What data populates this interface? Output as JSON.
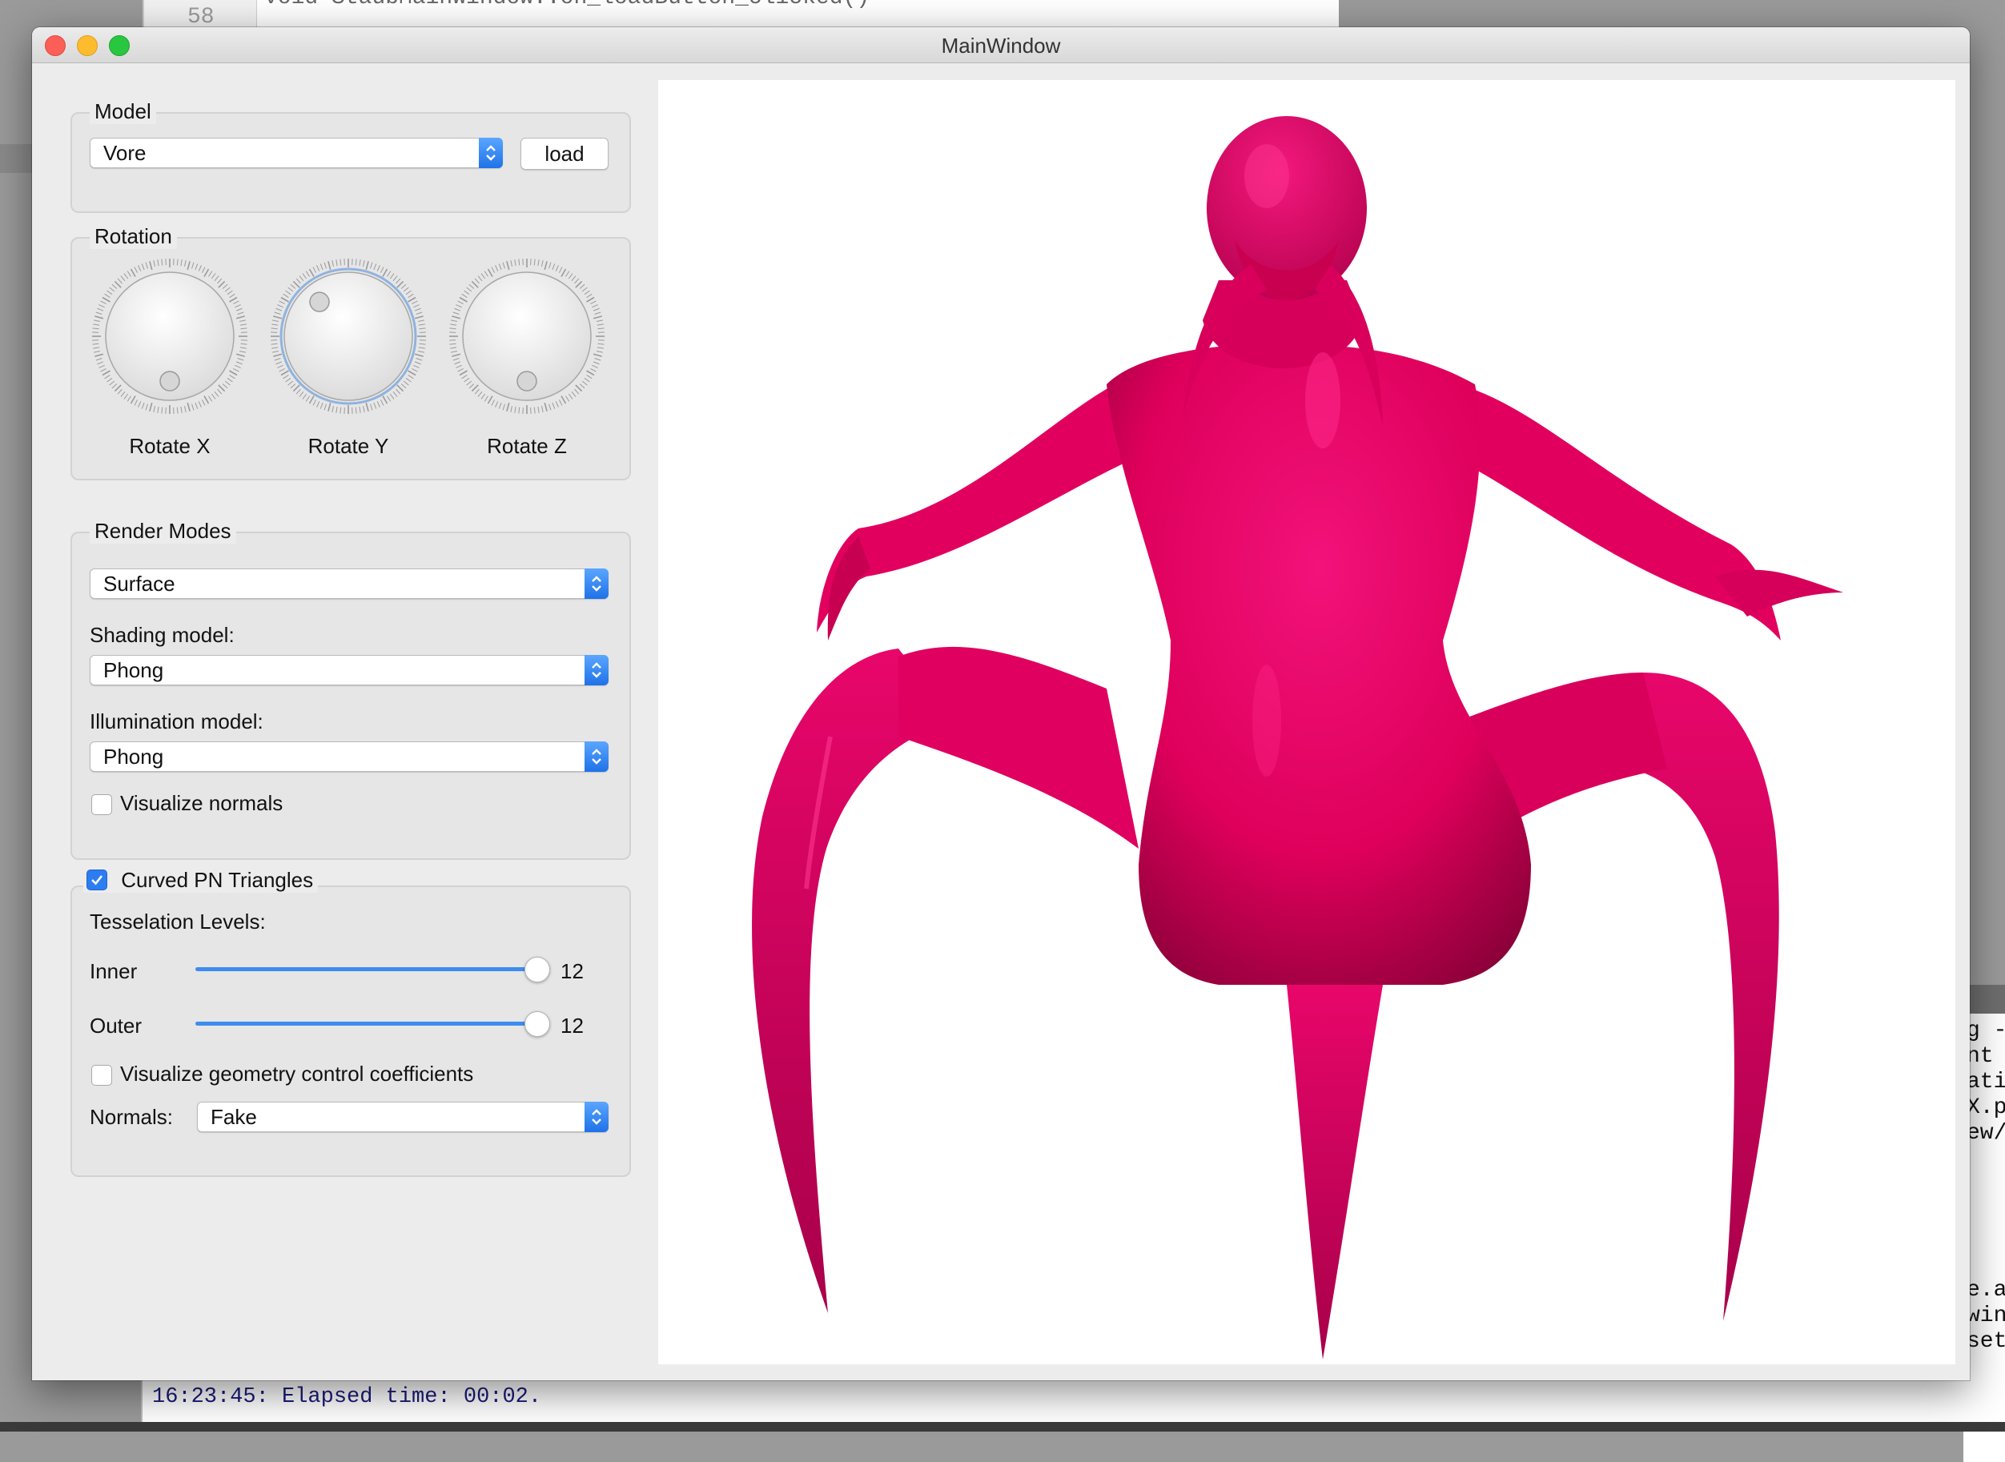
{
  "background": {
    "editor_line_no": "58",
    "editor_code": "void StaubMainWindow::on_loadButton_clicked()",
    "console_text": "16:23:45: Elapsed time: 00:02.",
    "right_terminal_lines": [
      "g -",
      "nt",
      "atio",
      "X.p",
      "ew/",
      "e.a",
      "win",
      "set"
    ]
  },
  "window": {
    "title": "MainWindow"
  },
  "model_group": {
    "title": "Model",
    "model_value": "Vore",
    "load_label": "load"
  },
  "rotation_group": {
    "title": "Rotation",
    "dials": [
      {
        "label": "Rotate X",
        "value_deg": 0
      },
      {
        "label": "Rotate Y",
        "value_deg": 140
      },
      {
        "label": "Rotate Z",
        "value_deg": 0
      }
    ]
  },
  "render_group": {
    "title": "Render Modes",
    "mode_value": "Surface",
    "shading_label": "Shading model:",
    "shading_value": "Phong",
    "illumination_label": "Illumination model:",
    "illumination_value": "Phong",
    "visualize_normals_label": "Visualize normals",
    "visualize_normals_checked": false
  },
  "pn_group": {
    "title": "Curved PN Triangles",
    "enabled": true,
    "levels_label": "Tesselation Levels:",
    "inner_label": "Inner",
    "inner_value": "12",
    "inner_fraction": 1.0,
    "outer_label": "Outer",
    "outer_value": "12",
    "outer_fraction": 1.0,
    "visualize_coeff_label": "Visualize geometry control coefficients",
    "visualize_coeff_checked": false,
    "normals_label": "Normals:",
    "normals_value": "Fake"
  },
  "colors": {
    "model_surface": "#e0005c",
    "accent": "#2b7df0"
  }
}
